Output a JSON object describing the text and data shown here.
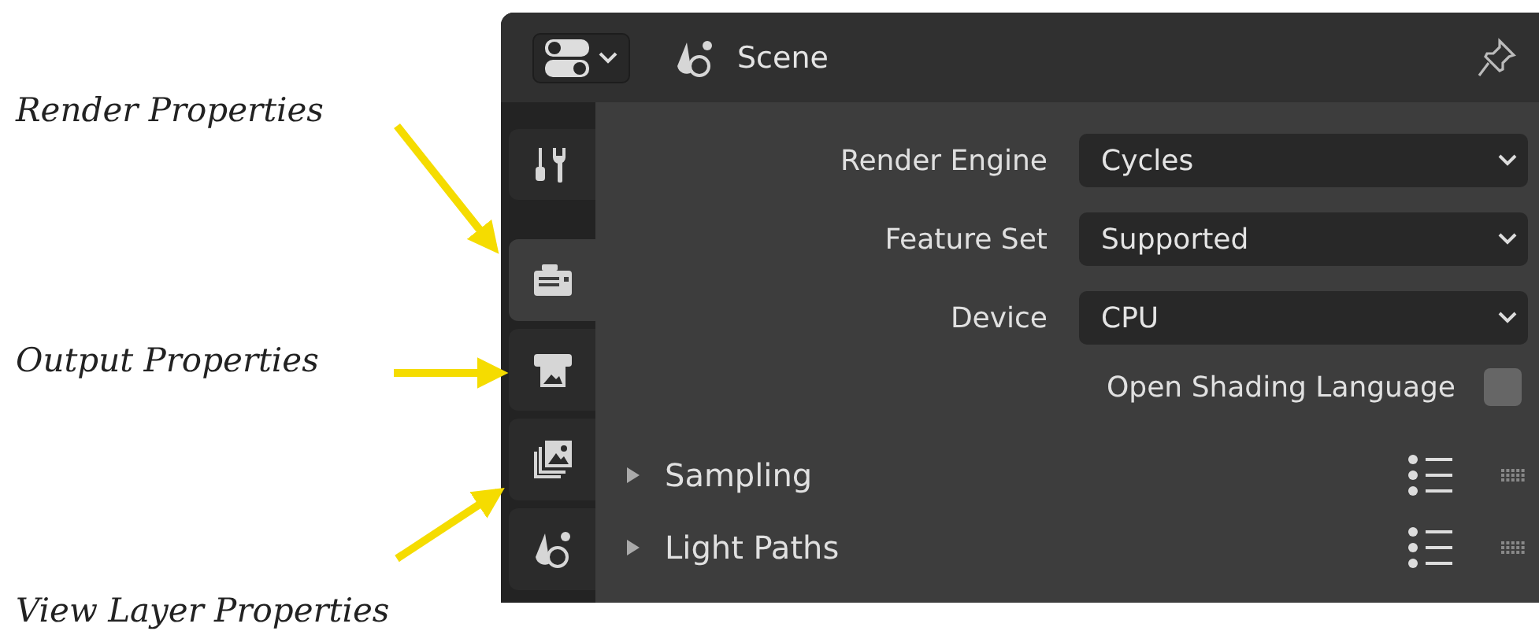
{
  "header": {
    "context": "Scene"
  },
  "tabs": [
    {
      "kind": "tool",
      "selected": false
    },
    {
      "kind": "render",
      "selected": true
    },
    {
      "kind": "output",
      "selected": false
    },
    {
      "kind": "view_layer",
      "selected": false
    },
    {
      "kind": "scene",
      "selected": false
    }
  ],
  "fields": [
    {
      "kind": "dropdown",
      "label": "Render Engine",
      "value": "Cycles"
    },
    {
      "kind": "dropdown",
      "label": "Feature Set",
      "value": "Supported"
    },
    {
      "kind": "dropdown",
      "label": "Device",
      "value": "CPU"
    },
    {
      "kind": "checkbox",
      "label": "Open Shading Language",
      "checked": false
    }
  ],
  "panels": [
    {
      "title": "Sampling",
      "expanded": false
    },
    {
      "title": "Light Paths",
      "expanded": false
    }
  ],
  "annotations": [
    {
      "text": "Render Properties"
    },
    {
      "text": "Output Properties"
    },
    {
      "text": "View Layer Properties"
    }
  ]
}
